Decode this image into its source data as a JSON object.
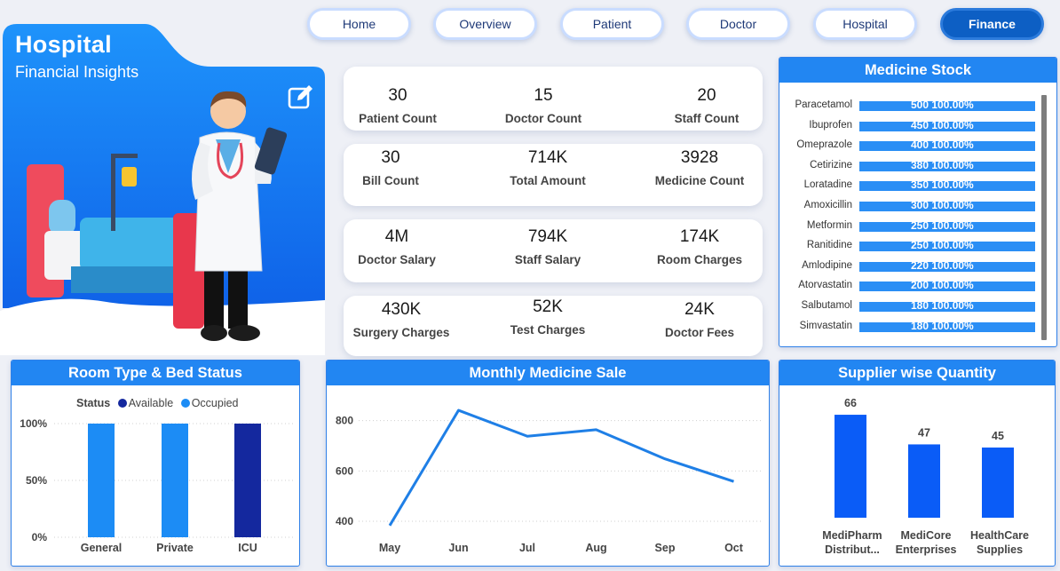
{
  "nav": {
    "items": [
      {
        "label": "Home",
        "active": false
      },
      {
        "label": "Overview",
        "active": false
      },
      {
        "label": "Patient",
        "active": false
      },
      {
        "label": "Doctor",
        "active": false
      },
      {
        "label": "Hospital",
        "active": false
      },
      {
        "label": "Finance",
        "active": true
      }
    ]
  },
  "hero": {
    "title": "Hospital",
    "subtitle": "Financial Insights",
    "edit_icon": "edit-icon"
  },
  "kpis": [
    [
      {
        "value": "30",
        "label": "Patient Count"
      },
      {
        "value": "15",
        "label": "Doctor Count"
      },
      {
        "value": "20",
        "label": "Staff Count"
      }
    ],
    [
      {
        "value": "30",
        "label": "Bill Count"
      },
      {
        "value": "714K",
        "label": "Total Amount"
      },
      {
        "value": "3928",
        "label": "Medicine Count"
      }
    ],
    [
      {
        "value": "4M",
        "label": "Doctor Salary"
      },
      {
        "value": "794K",
        "label": "Staff Salary"
      },
      {
        "value": "174K",
        "label": "Room Charges"
      }
    ],
    [
      {
        "value": "430K",
        "label": "Surgery Charges"
      },
      {
        "value": "52K",
        "label": "Test Charges"
      },
      {
        "value": "24K",
        "label": "Doctor Fees"
      }
    ]
  ],
  "medicine_stock": {
    "title": "Medicine Stock",
    "items": [
      {
        "name": "Paracetamol",
        "value": "500",
        "pct": "100.00%"
      },
      {
        "name": "Ibuprofen",
        "value": "450",
        "pct": "100.00%"
      },
      {
        "name": "Omeprazole",
        "value": "400",
        "pct": "100.00%"
      },
      {
        "name": "Cetirizine",
        "value": "380",
        "pct": "100.00%"
      },
      {
        "name": "Loratadine",
        "value": "350",
        "pct": "100.00%"
      },
      {
        "name": "Amoxicillin",
        "value": "300",
        "pct": "100.00%"
      },
      {
        "name": "Metformin",
        "value": "250",
        "pct": "100.00%"
      },
      {
        "name": "Ranitidine",
        "value": "250",
        "pct": "100.00%"
      },
      {
        "name": "Amlodipine",
        "value": "220",
        "pct": "100.00%"
      },
      {
        "name": "Atorvastatin",
        "value": "200",
        "pct": "100.00%"
      },
      {
        "name": "Salbutamol",
        "value": "180",
        "pct": "100.00%"
      },
      {
        "name": "Simvastatin",
        "value": "180",
        "pct": "100.00%"
      }
    ]
  },
  "room_panel": {
    "title": "Room Type & Bed Status",
    "legend_title": "Status",
    "legend": [
      {
        "name": "Available",
        "color": "#14289e"
      },
      {
        "name": "Occupied",
        "color": "#1c8cf5"
      }
    ]
  },
  "sale_panel": {
    "title": "Monthly Medicine Sale"
  },
  "supplier_panel": {
    "title": "Supplier wise Quantity"
  },
  "colors": {
    "accent": "#2286f2",
    "nav_active": "#0d5fc4",
    "available": "#14289e",
    "occupied": "#1c8cf5",
    "supplier_bar": "#0a5cf7",
    "line": "#1f7fe6"
  },
  "chart_data": [
    {
      "type": "bar",
      "title": "Room Type & Bed Status",
      "categories": [
        "General",
        "Private",
        "ICU"
      ],
      "series": [
        {
          "name": "Available",
          "values": [
            0,
            0,
            1
          ]
        },
        {
          "name": "Occupied",
          "values": [
            1,
            1,
            0
          ]
        }
      ],
      "stacked": "100%",
      "ytick_labels": [
        "0%",
        "50%",
        "100%"
      ],
      "ylim": [
        0,
        1
      ]
    },
    {
      "type": "line",
      "title": "Monthly Medicine Sale",
      "categories": [
        "May",
        "Jun",
        "Jul",
        "Aug",
        "Sep",
        "Oct"
      ],
      "values": [
        383,
        841,
        738,
        764,
        648,
        558
      ],
      "yticks": [
        400,
        600,
        800
      ],
      "ylim": [
        340,
        880
      ],
      "grid": true
    },
    {
      "type": "bar",
      "title": "Supplier wise Quantity",
      "categories": [
        [
          "MediPharm",
          "Distribut..."
        ],
        [
          "MediCore",
          "Enterprises"
        ],
        [
          "HealthCare",
          "Supplies"
        ]
      ],
      "values": [
        66,
        47,
        45
      ],
      "ylim": [
        0,
        74
      ]
    }
  ]
}
